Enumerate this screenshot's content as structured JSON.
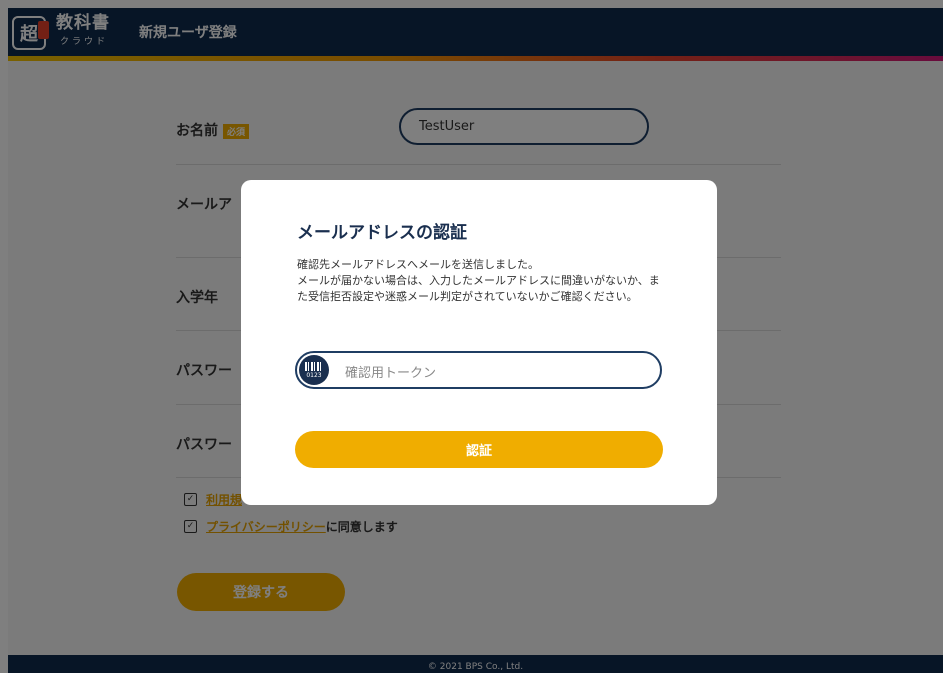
{
  "header": {
    "logo_mark": "超",
    "logo_text": "教科書",
    "logo_sub": "クラウド",
    "title": "新規ユーザ登録"
  },
  "form": {
    "name_label": "お名前",
    "required_badge": "必須",
    "name_value": "TestUser",
    "email_label": "メールア",
    "year_label": "入学年",
    "password_label": "パスワー",
    "password_confirm_label": "パスワー"
  },
  "agreements": {
    "terms_link": "利用規",
    "privacy_link": "プライバシーポリシー",
    "privacy_suffix": "に同意します",
    "check_glyph": "✓"
  },
  "register_button": "登録する",
  "footer": "© 2021 BPS Co., Ltd.",
  "modal": {
    "title": "メールアドレスの認証",
    "message_line1": "確認先メールアドレスへメールを送信しました。",
    "message_line2": "メールが届かない場合は、入力したメールアドレスに間違いがないか、また受信拒否設定や迷惑メール判定がされていないかご確認ください。",
    "token_placeholder": "確認用トークン",
    "token_icon_text": "0123",
    "verify_button": "認証"
  },
  "colors": {
    "header": "#0f2a4d",
    "accent": "#f0ad00",
    "overlay": "rgba(0,0,0,0.5)"
  },
  "icons": {
    "token_field": "barcode-icon",
    "checkbox": "checkbox-checked-icon"
  }
}
